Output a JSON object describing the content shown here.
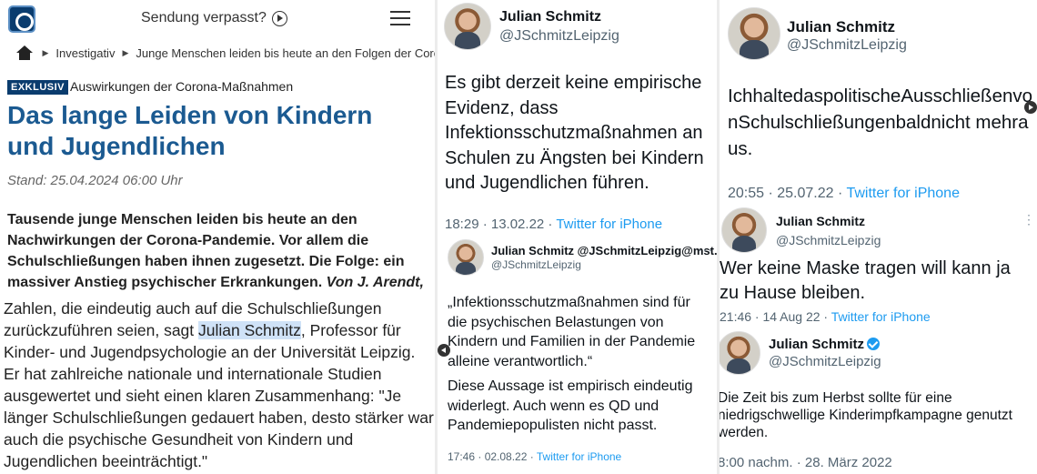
{
  "article": {
    "nav": {
      "sendung": "Sendung verpasst?"
    },
    "breadcrumb": [
      "Investigativ",
      "Junge Menschen leiden bis heute an den Folgen der Coro"
    ],
    "badge": "EXKLUSIV",
    "kicker": "Auswirkungen der Corona-Maßnahmen",
    "headline": "Das lange Leiden von Kindern und Jugendlichen",
    "stand": "Stand: 25.04.2024 06:00 Uhr",
    "lead": "Tausende junge Menschen leiden bis heute an den Nachwirkungen der Corona-Pandemie. Vor allem die Schulschließungen haben ihnen zugesetzt. Die Folge: ein massiver Anstieg psychischer Erkrankungen. ",
    "byline": "Von J. Arendt,",
    "body_before": "Zahlen, die eindeutig auch auf die Schulschließungen zurückzuführen seien, sagt ",
    "body_highlight": "Julian Schmitz",
    "body_after": ", Professor für Kinder- und Jugendpsychologie an der Universität Leipzig. Er hat zahlreiche nationale und internationale Studien ausgewertet und sieht einen klaren Zusammenhang: \"Je länger Schulschließungen gedauert haben, desto stärker war auch die psychische Gesundheit von Kindern und Jugendlichen beeinträchtigt.\""
  },
  "tweets": {
    "mid_main": {
      "name": "Julian Schmitz",
      "handle": "@JSchmitzLeipzig",
      "text": "Es gibt derzeit keine empirische Evidenz, dass Infektionsschutzmaßnahmen an Schulen zu Ängsten bei Kindern und Jugendlichen führen.",
      "time": "18:29 · 13.02.22 · ",
      "source": "Twitter for iPhone"
    },
    "mid_quote": {
      "name": "Julian Schmitz @JSchmitzLeipzig@mst...",
      "more": "···",
      "handle": "@JSchmitzLeipzig",
      "text1": "„Infektionsschutzmaßnahmen sind für die psychischen Belastungen von Kindern und Familien in der Pandemie alleine verantwortlich.“",
      "text2": "Diese Aussage ist empirisch eindeutig widerlegt. Auch wenn es QD und Pandemiepopulisten nicht passt.",
      "time": "17:46 · 02.08.22 · ",
      "source": "Twitter for iPhone"
    },
    "right_top": {
      "name": "Julian Schmitz",
      "handle": "@JSchmitzLeipzig",
      "text": "IchhaltedaspolitischeAusschließenvonSchulschließungenbaldnicht mehraus.",
      "time": "20:55 · 25.07.22 · ",
      "source": "Twitter for iPhone"
    },
    "right_mid": {
      "name": "Julian Schmitz",
      "more": "⋮",
      "handle": "@JSchmitzLeipzig",
      "text": "Wer keine Maske tragen will kann ja zu Hause bleiben.",
      "time": "21:46 · 14 Aug 22 · ",
      "source": "Twitter for iPhone"
    },
    "right_bottom": {
      "name": "Julian Schmitz",
      "handle": "@JSchmitzLeipzig",
      "text": "Die Zeit bis zum Herbst sollte für eine niedrigschwellige Kinderimpfkampagne genutzt werden.",
      "time": "8:00 nachm. · 28. März 2022"
    }
  }
}
